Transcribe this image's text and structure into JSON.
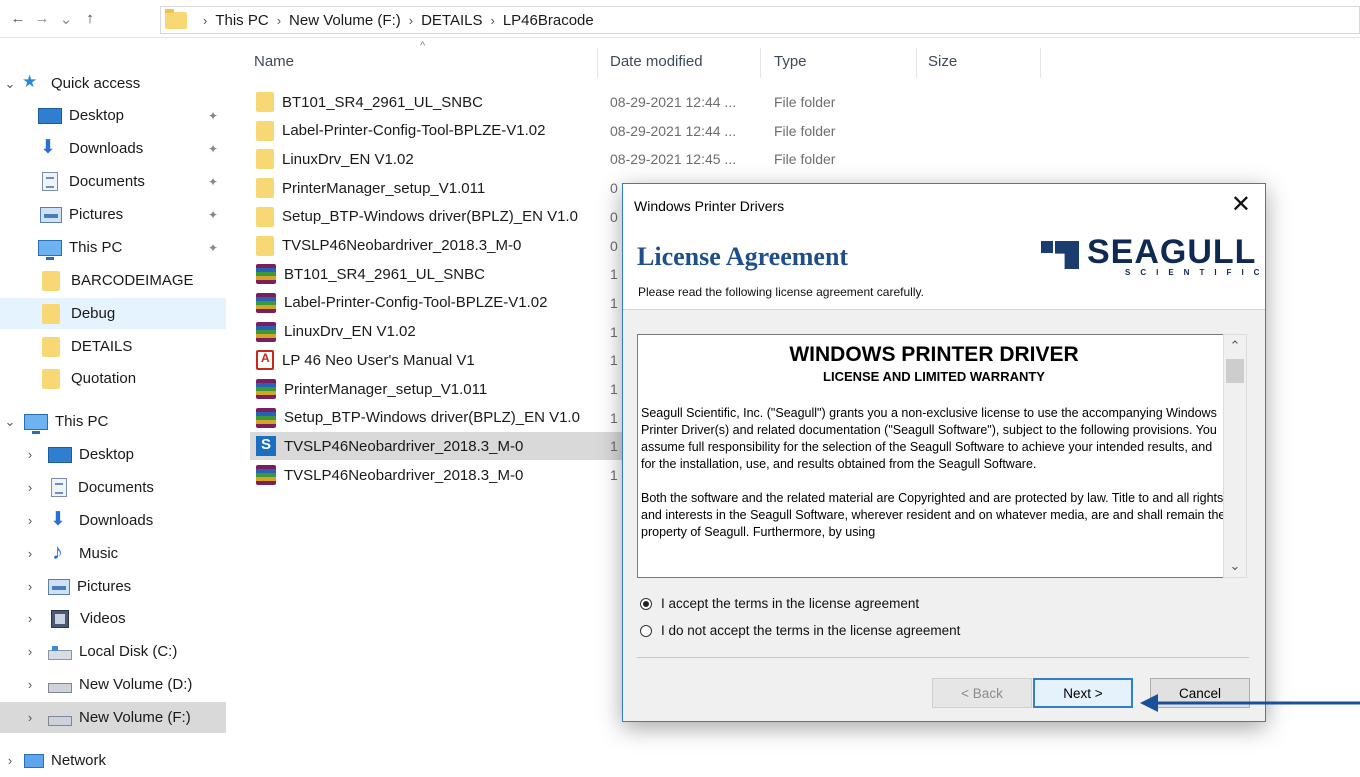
{
  "explorer": {
    "breadcrumb": [
      "This PC",
      "New Volume (F:)",
      "DETAILS",
      "LP46Bracode"
    ],
    "columns": {
      "name": "Name",
      "date": "Date modified",
      "type": "Type",
      "size": "Size"
    },
    "files": [
      {
        "name": "BT101_SR4_2961_UL_SNBC",
        "date": "08-29-2021 12:44 ...",
        "type": "File folder",
        "icon": "folder-icon"
      },
      {
        "name": "Label-Printer-Config-Tool-BPLZE-V1.02",
        "date": "08-29-2021 12:44 ...",
        "type": "File folder",
        "icon": "folder-icon"
      },
      {
        "name": "LinuxDrv_EN V1.02",
        "date": "08-29-2021 12:45 ...",
        "type": "File folder",
        "icon": "folder-icon"
      },
      {
        "name": "PrinterManager_setup_V1.011",
        "date": "0",
        "type": "",
        "icon": "folder-icon"
      },
      {
        "name": "Setup_BTP-Windows driver(BPLZ)_EN V1.0",
        "date": "0",
        "type": "",
        "icon": "folder-icon"
      },
      {
        "name": "TVSLP46Neobardriver_2018.3_M-0",
        "date": "0",
        "type": "",
        "icon": "folder-icon"
      },
      {
        "name": "BT101_SR4_2961_UL_SNBC",
        "date": "1",
        "type": "",
        "icon": "rar-archive-icon"
      },
      {
        "name": "Label-Printer-Config-Tool-BPLZE-V1.02",
        "date": "1",
        "type": "",
        "icon": "rar-archive-icon"
      },
      {
        "name": "LinuxDrv_EN V1.02",
        "date": "1",
        "type": "",
        "icon": "rar-archive-icon"
      },
      {
        "name": "LP 46 Neo User's Manual V1",
        "date": "1",
        "type": "",
        "icon": "pdf-icon"
      },
      {
        "name": "PrinterManager_setup_V1.011",
        "date": "1",
        "type": "",
        "icon": "rar-archive-icon"
      },
      {
        "name": "Setup_BTP-Windows driver(BPLZ)_EN V1.0",
        "date": "1",
        "type": "",
        "icon": "rar-archive-icon"
      },
      {
        "name": "TVSLP46Neobardriver_2018.3_M-0",
        "date": "1",
        "type": "",
        "icon": "seagull-installer-icon"
      },
      {
        "name": "TVSLP46Neobardriver_2018.3_M-0",
        "date": "1",
        "type": "",
        "icon": "rar-archive-icon"
      }
    ],
    "selected_file_index": 12
  },
  "nav": {
    "quick_access": "Quick access",
    "quick_items": [
      {
        "label": "Desktop",
        "icon": "desktop-icon",
        "pinned": true
      },
      {
        "label": "Downloads",
        "icon": "downloads-icon",
        "pinned": true
      },
      {
        "label": "Documents",
        "icon": "documents-icon",
        "pinned": true
      },
      {
        "label": "Pictures",
        "icon": "pictures-icon",
        "pinned": true
      },
      {
        "label": "This PC",
        "icon": "this-pc-icon",
        "pinned": true
      },
      {
        "label": "BARCODEIMAGE",
        "icon": "folder-icon",
        "pinned": false
      },
      {
        "label": "Debug",
        "icon": "folder-icon",
        "pinned": false
      },
      {
        "label": "DETAILS",
        "icon": "folder-icon",
        "pinned": false
      },
      {
        "label": "Quotation",
        "icon": "folder-icon",
        "pinned": false
      }
    ],
    "this_pc": "This PC",
    "pc_items": [
      {
        "label": "Desktop",
        "icon": "desktop-icon"
      },
      {
        "label": "Documents",
        "icon": "documents-icon"
      },
      {
        "label": "Downloads",
        "icon": "downloads-icon"
      },
      {
        "label": "Music",
        "icon": "music-icon"
      },
      {
        "label": "Pictures",
        "icon": "pictures-icon"
      },
      {
        "label": "Videos",
        "icon": "videos-icon"
      },
      {
        "label": "Local Disk (C:)",
        "icon": "local-disk-icon"
      },
      {
        "label": "New Volume (D:)",
        "icon": "drive-icon"
      },
      {
        "label": "New Volume (F:)",
        "icon": "drive-icon"
      }
    ],
    "network": "Network"
  },
  "dialog": {
    "window_title": "Windows Printer Drivers",
    "heading": "License Agreement",
    "subheading": "Please read the following license agreement carefully.",
    "logo_word": "SEAGULL",
    "logo_sub": "SCIENTIFIC",
    "license_title": "WINDOWS PRINTER DRIVER",
    "license_subtitle": "LICENSE AND LIMITED WARRANTY",
    "license_para1": "Seagull Scientific, Inc. (\"Seagull\") grants you a non-exclusive license to use the accompanying Windows Printer Driver(s) and related documentation (\"Seagull Software\"), subject to the following provisions. You assume full responsibility for the selection of the Seagull Software to achieve your intended results, and for the installation, use, and results obtained from the Seagull Software.",
    "license_para2": "Both the software and the related material are Copyrighted and are protected by law. Title to and all rights and interests in the Seagull Software, wherever resident and on whatever media, are and shall remain the property of Seagull. Furthermore, by using",
    "accept_label": "I accept the terms in the license agreement",
    "decline_label": "I do not accept the terms in the license agreement",
    "accept_selected": true,
    "back_label": "< Back",
    "next_label": "Next >",
    "cancel_label": "Cancel"
  },
  "colors": {
    "accent": "#2f7fd1",
    "heading": "#1e4f8a",
    "arrow": "#1b4f9c",
    "selection": "#cce8ff"
  }
}
